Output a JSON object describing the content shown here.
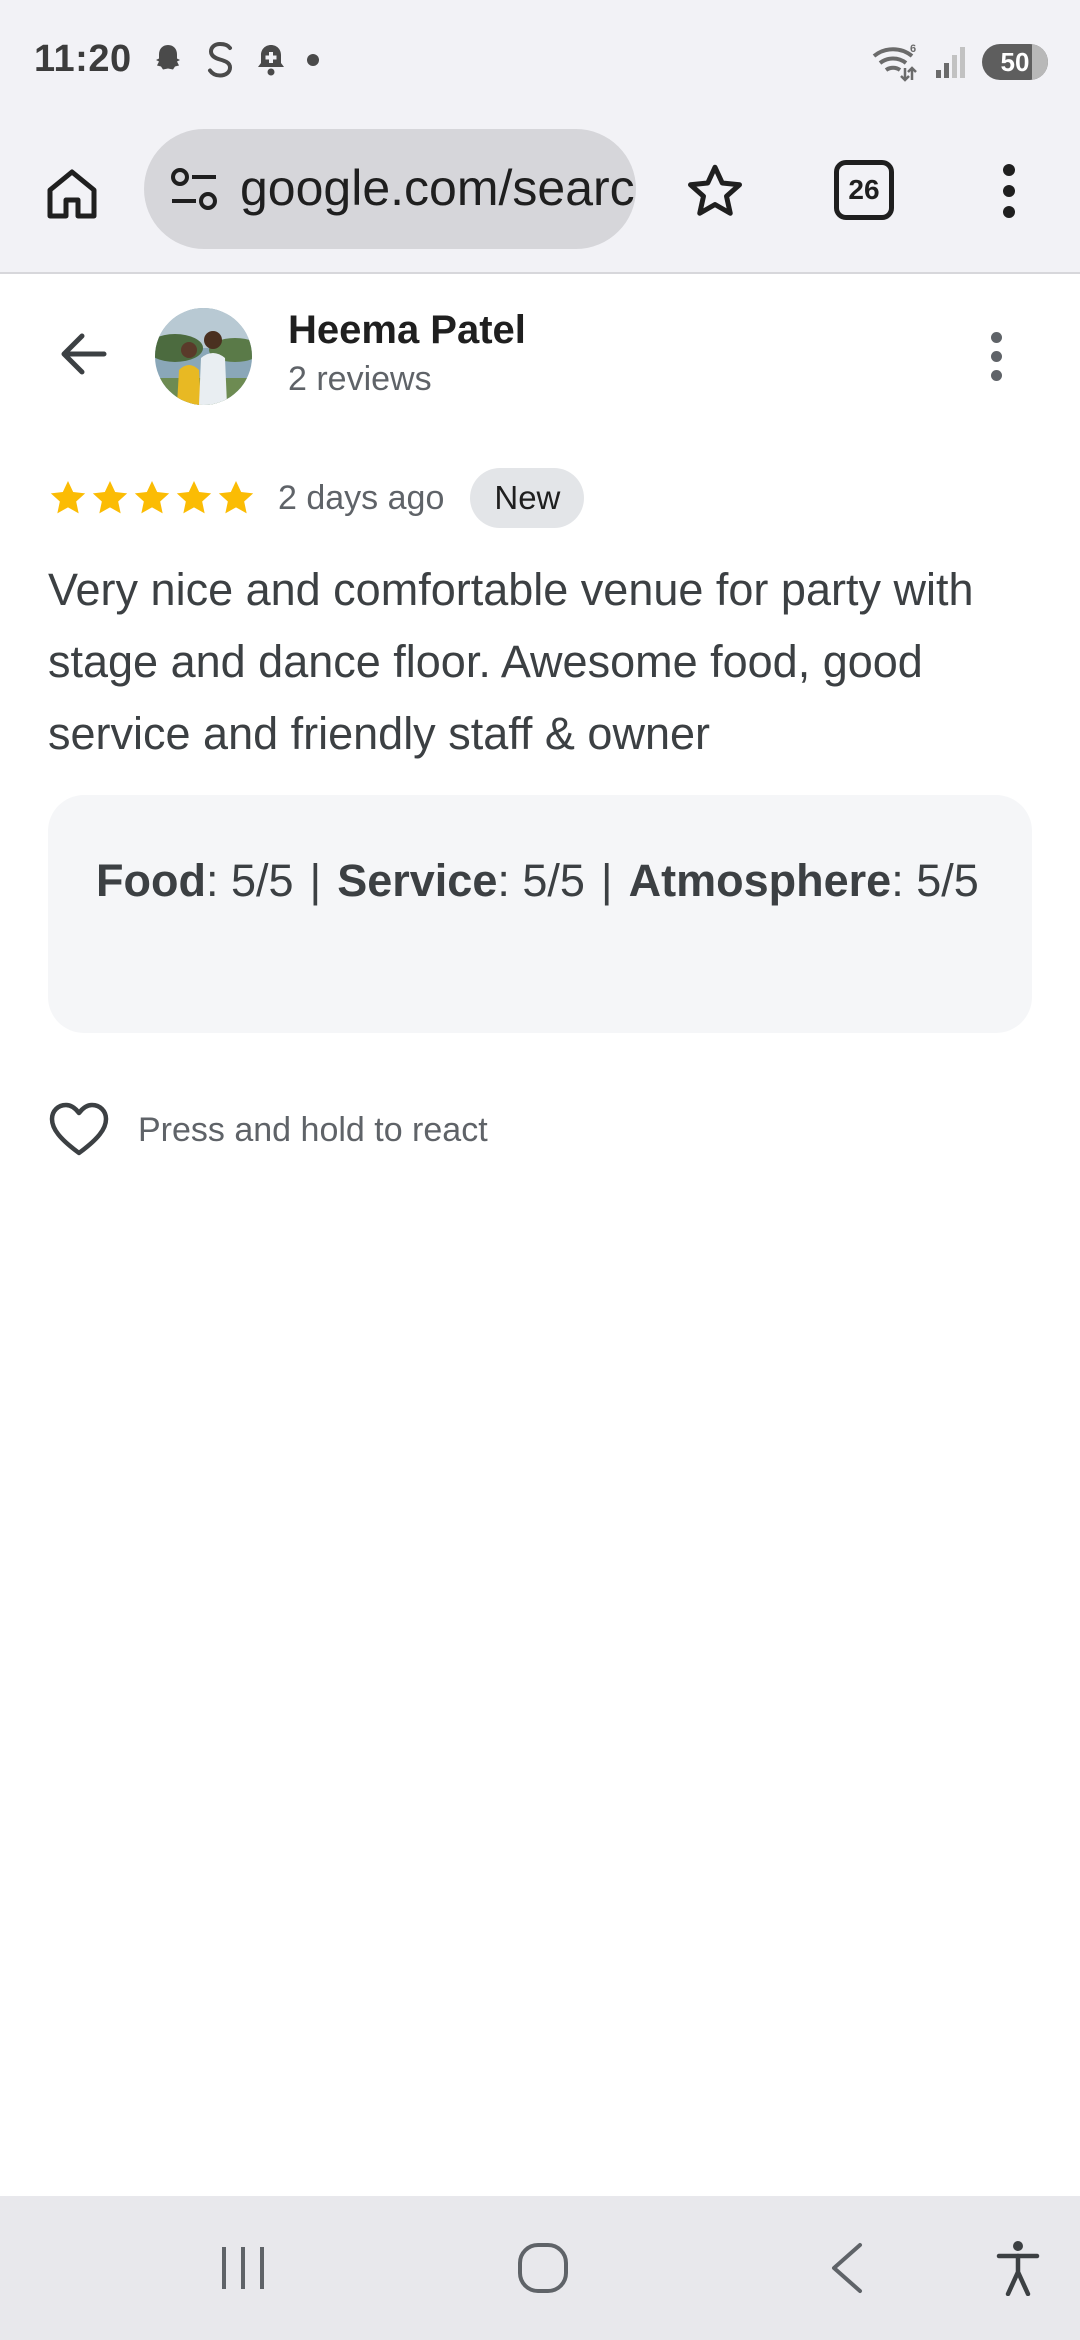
{
  "status_bar": {
    "time": "11:20",
    "left_icons": [
      "snapchat-icon",
      "s-app-icon",
      "notification-bell-icon",
      "dot-icon"
    ],
    "right_icons": [
      "wifi-icon",
      "signal-icon"
    ],
    "wifi_label": "6",
    "battery": "50"
  },
  "browser": {
    "url": "google.com/search",
    "tab_count": "26"
  },
  "review": {
    "author_name": "Heema Patel",
    "author_reviews": "2 reviews",
    "rating": 5,
    "time": "2 days ago",
    "badge": "New",
    "text": "Very nice and comfortable venue for party with stage and dance floor. Awesome food, good service and friendly staff & owner",
    "subratings": [
      {
        "label": "Food",
        "value": ": 5/5"
      },
      {
        "label": "Service",
        "value": ": 5/5"
      },
      {
        "label": "Atmosphere",
        "value": ": 5/5"
      }
    ],
    "react_hint": "Press and hold to react"
  },
  "colors": {
    "star": "#fbbc04",
    "chrome_bg": "#f2f2f6",
    "url_pill": "#d6d6da"
  }
}
